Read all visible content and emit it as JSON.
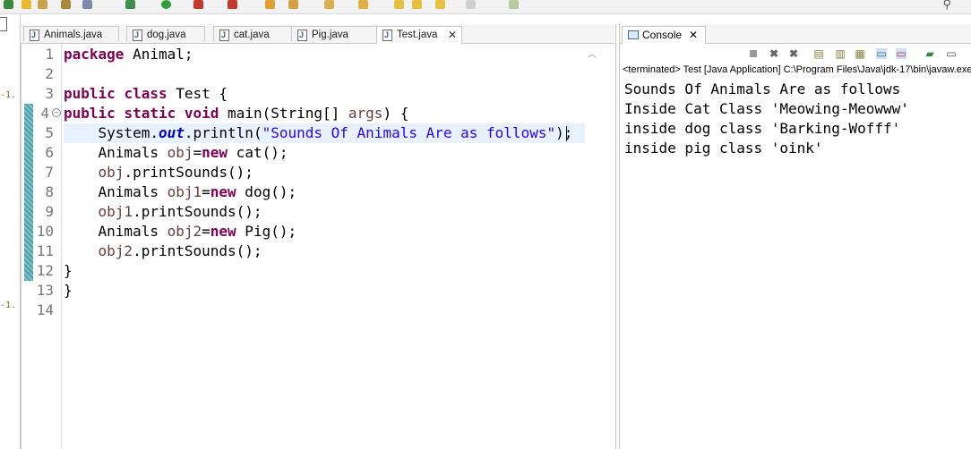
{
  "editor": {
    "tabs": [
      {
        "label": "Animals.java"
      },
      {
        "label": "dog.java"
      },
      {
        "label": "cat.java"
      },
      {
        "label": "Pig.java"
      },
      {
        "label": "Test.java",
        "active": true
      }
    ],
    "lines": [
      {
        "n": "1",
        "text": ""
      },
      {
        "n": "2",
        "text": ""
      },
      {
        "n": "3",
        "text": ""
      },
      {
        "n": "4",
        "text": ""
      },
      {
        "n": "5",
        "text": ""
      },
      {
        "n": "6",
        "text": ""
      },
      {
        "n": "7",
        "text": ""
      },
      {
        "n": "8",
        "text": ""
      },
      {
        "n": "9",
        "text": ""
      },
      {
        "n": "10",
        "text": ""
      },
      {
        "n": "11",
        "text": ""
      },
      {
        "n": "12",
        "text": ""
      },
      {
        "n": "13",
        "text": ""
      },
      {
        "n": "14",
        "text": ""
      }
    ],
    "code": {
      "l1_kw": "package",
      "l1_rest": " Animal;",
      "l3_kw1": "public",
      "l3_kw2": "class",
      "l3_rest": " Test {",
      "l4_kw1": "public",
      "l4_kw2": "static",
      "l4_kw3": "void",
      "l4_mid": " main(String[] ",
      "l4_var": "args",
      "l4_end": ") {",
      "l5_a": "    System.",
      "l5_fld": "out",
      "l5_b": ".println(",
      "l5_str": "\"Sounds Of Animals Are as follows\"",
      "l5_c": ");",
      "l6_a": "    Animals ",
      "l6_var": "obj",
      "l6_b": "=",
      "l6_kw": "new",
      "l6_c": " cat();",
      "l7_var": "    obj",
      "l7_b": ".printSounds();",
      "l8_a": "    Animals ",
      "l8_var": "obj1",
      "l8_b": "=",
      "l8_kw": "new",
      "l8_c": " dog();",
      "l9_var": "    obj1",
      "l9_b": ".printSounds();",
      "l10_a": "    Animals ",
      "l10_var": "obj2",
      "l10_b": "=",
      "l10_kw": "new",
      "l10_c": " Pig();",
      "l11_var": "    obj2",
      "l11_b": ".printSounds();",
      "l12": "}",
      "l13": "}"
    }
  },
  "console": {
    "tab_label": "Console",
    "status": "<terminated> Test [Java Application] C:\\Program Files\\Java\\jdk-17\\bin\\javaw.exe",
    "output": [
      "Sounds Of Animals Are as follows",
      "Inside Cat Class 'Meowing-Meowww'",
      "inside dog class 'Barking-Wofff'",
      "inside pig class 'oink'"
    ]
  },
  "left_strip": {
    "marks": [
      "-1.",
      "-1."
    ]
  },
  "colors": {
    "keyword": "#7f0055",
    "string": "#2a00ff",
    "field": "#0000c0",
    "highlight": "#e8f2fe"
  }
}
